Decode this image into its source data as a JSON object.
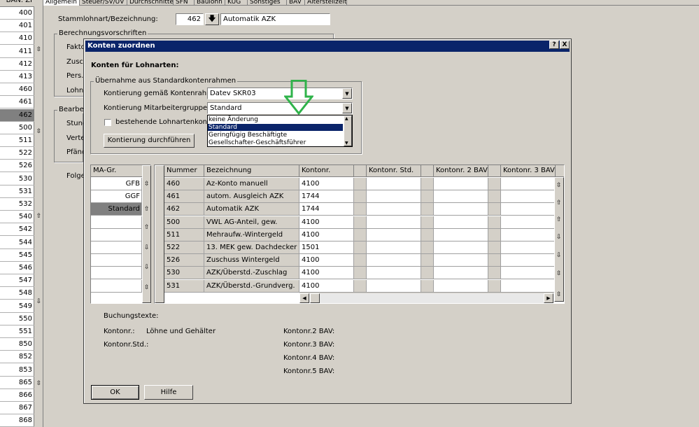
{
  "left_list": {
    "header": "BAN. ZI",
    "rows": [
      "400",
      "401",
      "410",
      "411",
      "412",
      "413",
      "460",
      "461",
      "462",
      "500",
      "511",
      "522",
      "526",
      "530",
      "531",
      "532",
      "540",
      "542",
      "544",
      "545",
      "546",
      "547",
      "548",
      "549",
      "550",
      "551",
      "850",
      "852",
      "853",
      "865",
      "866",
      "867",
      "868"
    ],
    "selected": "462"
  },
  "tabs": [
    "Allgemein",
    "Steuer/SV/UV",
    "Durchschnitte",
    "SFN",
    "Baulohn",
    "KUG",
    "Sonstiges",
    "BAV",
    "Altersteilzeit"
  ],
  "background_form": {
    "stammlohnart_label": "Stammlohnart/Bezeichnung:",
    "stammlohnart_number": "462",
    "stammlohnart_name": "Automatik AZK",
    "berechnungsvorschriften_label": "Berechnungsvorschriften",
    "fakto_label": "Fakto",
    "zusch_label": "Zusch",
    "pers_label": "Pers.",
    "lohnv_label": "Lohnv",
    "bearbeit_label": "Bearbeit",
    "stund_label": "Stund",
    "verte_label": "Verte",
    "pfaend_label": "Pfänd",
    "folge_label": "Folge"
  },
  "dialog": {
    "title": "Konten zuordnen",
    "help_btn": "?",
    "close_btn": "X",
    "heading": "Konten für Lohnarten:",
    "group_label": "Übernahme aus Standardkontenrahmen",
    "kontierung_kontenrahmen_label": "Kontierung gemäß Kontenrahmen:",
    "kontierung_kontenrahmen_value": "Datev SKR03",
    "kontierung_mitarbeiter_label": "Kontierung Mitarbeitergruppe:",
    "kontierung_mitarbeiter_value": "Standard",
    "bestehende_label": "bestehende Lohnartenkontierun",
    "dropdown_options": [
      "keine Änderung",
      "Standard",
      "Geringfügig Beschäftigte",
      "Gesellschafter-Geschäftsführer"
    ],
    "dropdown_selected": "Standard",
    "durchfuehren_btn": "Kontierung durchführen",
    "ma_header": "MA-Gr.",
    "ma_rows": [
      "GFB",
      "GGF",
      "Standard",
      "",
      "",
      "",
      "",
      "",
      ""
    ],
    "ma_selected": "Standard",
    "table_headers": [
      "Nummer",
      "Bezeichnung",
      "Kontonr.",
      "Kontonr. Std.",
      "Kontonr. 2 BAV",
      "Kontonr. 3 BAV"
    ],
    "table_rows": [
      [
        "460",
        "Az-Konto manuell",
        "4100"
      ],
      [
        "461",
        "autom. Ausgleich AZK",
        "1744"
      ],
      [
        "462",
        "Automatik AZK",
        "1744"
      ],
      [
        "500",
        "VWL AG-Anteil, gew.",
        "4100"
      ],
      [
        "511",
        "Mehraufw.-Wintergeld",
        "4100"
      ],
      [
        "522",
        "13. MEK gew. Dachdecker",
        "1501"
      ],
      [
        "526",
        "Zuschuss Wintergeld",
        "4100"
      ],
      [
        "530",
        "AZK/Überstd.-Zuschlag",
        "4100"
      ],
      [
        "531",
        "AZK/Überstd.-Grundverg.",
        "4100"
      ]
    ],
    "buchungstexte_label": "Buchungstexte:",
    "kontonr_label": "Kontonr.:",
    "kontonr_value": "Löhne und Gehälter",
    "kontonr_std_label": "Kontonr.Std.:",
    "kontonr2_label": "Kontonr.2 BAV:",
    "kontonr3_label": "Kontonr.3 BAV:",
    "kontonr4_label": "Kontonr.4 BAV:",
    "kontonr5_label": "Kontonr.5 BAV:",
    "ok_btn": "OK",
    "hilfe_btn": "Hilfe"
  },
  "colors": {
    "titlebar": "#0a246a",
    "selection": "#0a246a",
    "arrow": "#2fb34a",
    "face": "#d4d0c8"
  }
}
